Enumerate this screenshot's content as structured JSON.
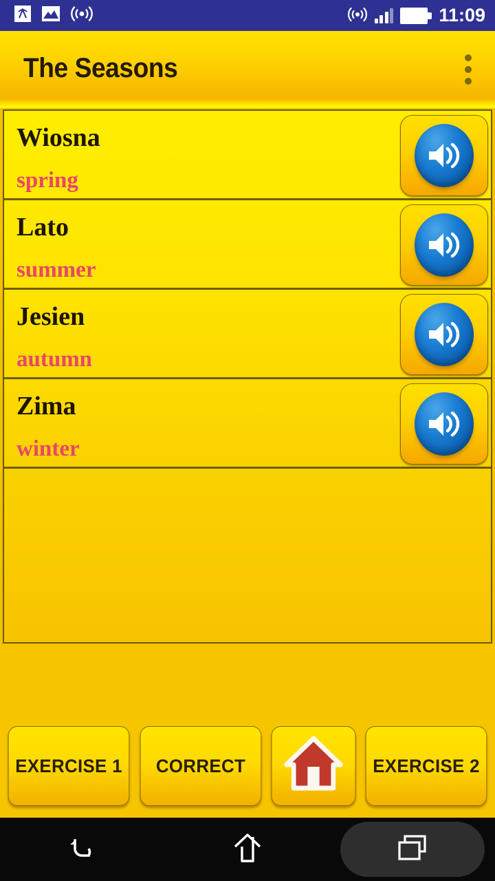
{
  "status_bar": {
    "left_icons": [
      "broadcast-box-icon",
      "image-icon",
      "wireless-signal-icon"
    ],
    "right_icons": [
      "hotspot-icon",
      "cellular-signal-icon",
      "battery-icon"
    ],
    "time": "11:09",
    "background_color": "#2E3192"
  },
  "app_bar": {
    "title": "The Seasons",
    "overflow_menu": "overflow-menu",
    "accent_color": "#FFD400"
  },
  "list": {
    "rows": [
      {
        "word": "Wiosna",
        "translation": "spring",
        "speaker": "speaker-icon"
      },
      {
        "word": "Lato",
        "translation": "summer",
        "speaker": "speaker-icon"
      },
      {
        "word": "Jesien",
        "translation": "autumn",
        "speaker": "speaker-icon"
      },
      {
        "word": "Zima",
        "translation": "winter",
        "speaker": "speaker-icon"
      }
    ],
    "word_color": "#1d1506",
    "translation_color": "#EA4668"
  },
  "bottom_bar": {
    "buttons": [
      {
        "label": "EXERCISE 1"
      },
      {
        "label": "CORRECT"
      },
      {
        "label": "",
        "icon": "home-house-icon"
      },
      {
        "label": "EXERCISE 2"
      }
    ]
  },
  "nav_bar": {
    "back": "back-icon",
    "home": "home-icon",
    "recents": "recents-icon",
    "background_color": "#090909"
  }
}
